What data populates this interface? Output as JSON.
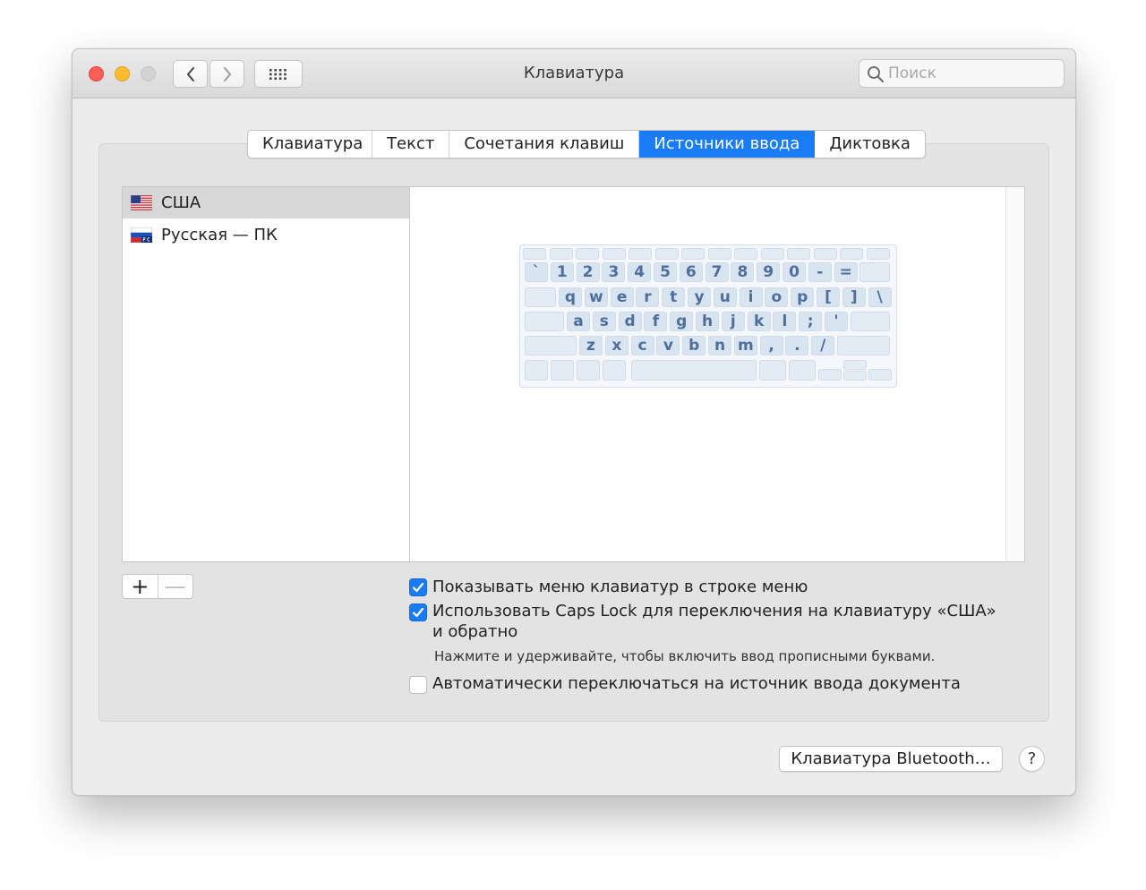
{
  "window": {
    "title": "Клавиатура",
    "search_placeholder": "Поиск"
  },
  "tabs": [
    {
      "label": "Клавиатура",
      "active": false
    },
    {
      "label": "Текст",
      "active": false
    },
    {
      "label": "Сочетания клавиш",
      "active": false
    },
    {
      "label": "Источники ввода",
      "active": true
    },
    {
      "label": "Диктовка",
      "active": false
    }
  ],
  "input_sources": [
    {
      "label": "США",
      "flag": "us-flag-icon",
      "selected": true
    },
    {
      "label": "Русская — ПК",
      "flag": "ru-flag-icon",
      "selected": false
    }
  ],
  "list_controls": {
    "add": "+",
    "remove": "—"
  },
  "keyboard_rows": [
    [
      "`",
      "1",
      "2",
      "3",
      "4",
      "5",
      "6",
      "7",
      "8",
      "9",
      "0",
      "-",
      "="
    ],
    [
      "q",
      "w",
      "e",
      "r",
      "t",
      "y",
      "u",
      "i",
      "o",
      "p",
      "[",
      "]",
      "\\"
    ],
    [
      "a",
      "s",
      "d",
      "f",
      "g",
      "h",
      "j",
      "k",
      "l",
      ";",
      "'"
    ],
    [
      "z",
      "x",
      "c",
      "v",
      "b",
      "n",
      "m",
      ",",
      ".",
      "/"
    ]
  ],
  "options": {
    "show_menu": {
      "label": "Показывать меню клавиатур в строке меню",
      "checked": true
    },
    "caps_lock": {
      "label_line1": "Использовать Caps Lock для переключения на клавиатуру «США»",
      "label_line2": "и обратно",
      "checked": true
    },
    "caps_lock_note": "Нажмите и удерживайте, чтобы включить ввод прописными буквами.",
    "auto_switch": {
      "label": "Автоматически переключаться на источник ввода документа",
      "checked": false
    }
  },
  "footer": {
    "bluetooth_button": "Клавиатура Bluetooth…",
    "help_button": "?"
  },
  "colors": {
    "accent": "#1a7cf5",
    "key_text": "#4e6e9c"
  }
}
